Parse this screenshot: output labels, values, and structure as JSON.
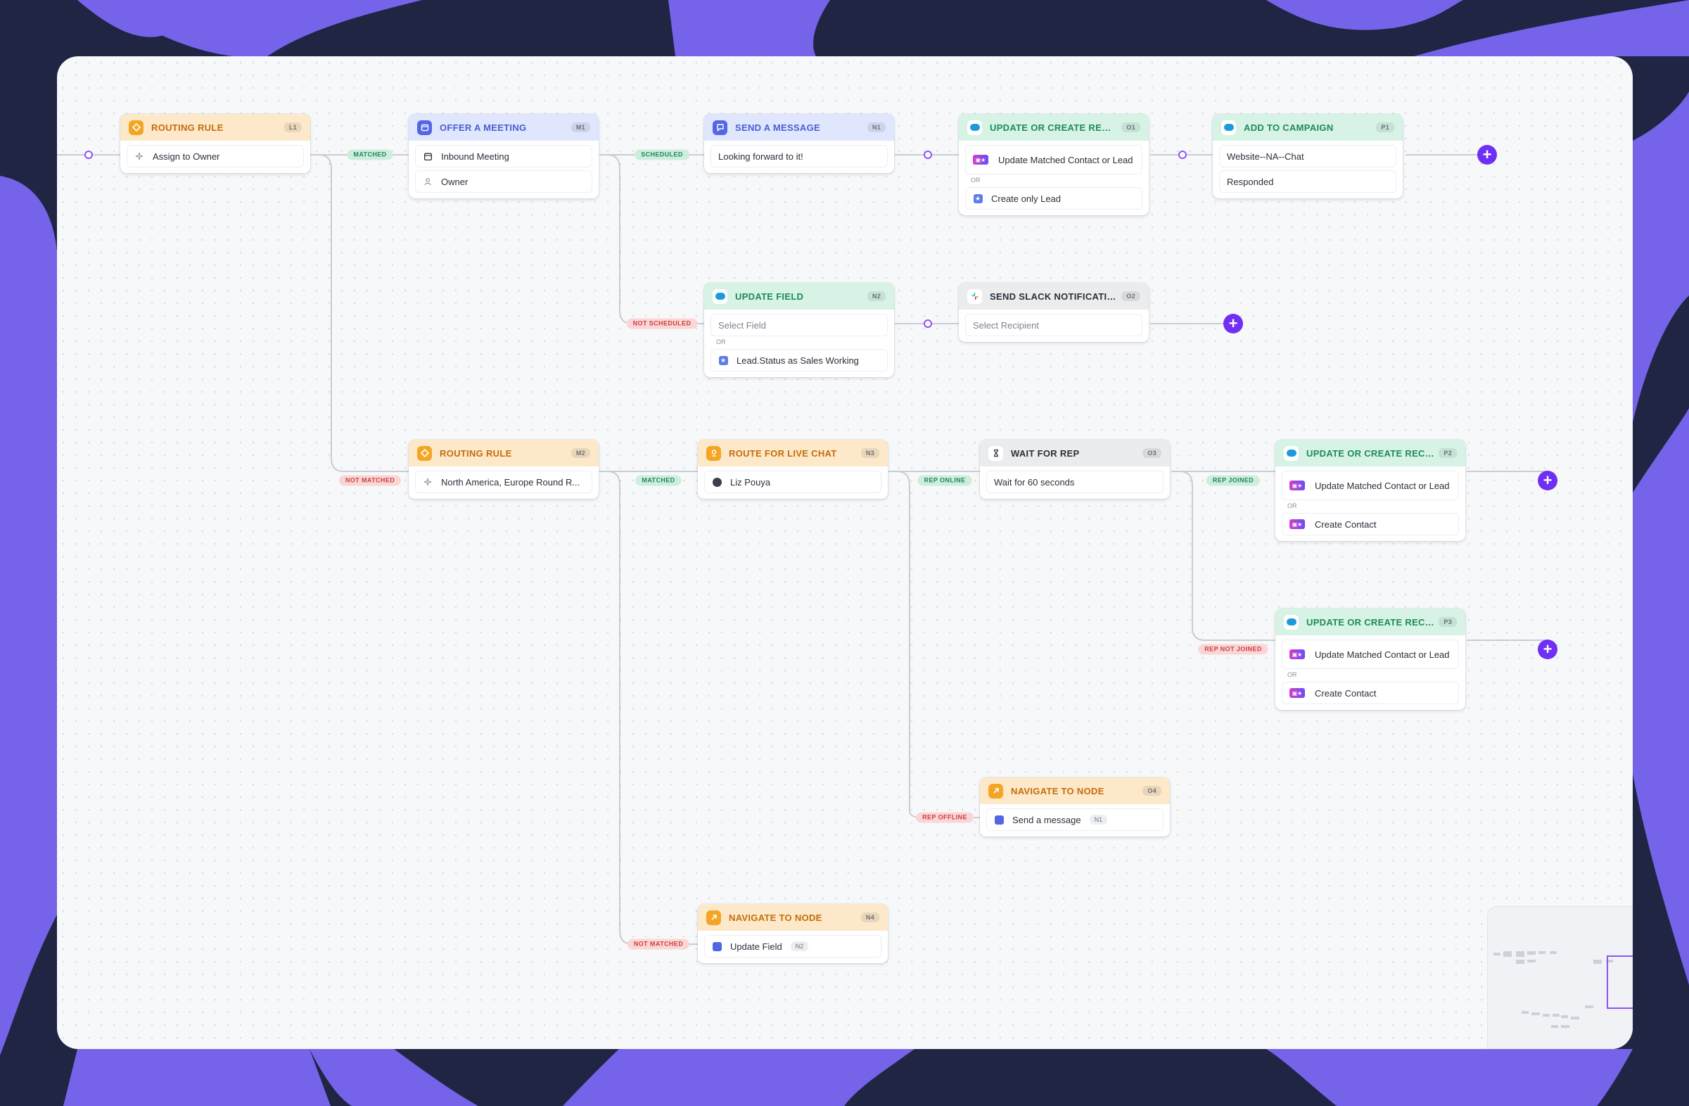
{
  "colors": {
    "accent": "#6f2ff5",
    "orange": "#f5a524",
    "blue": "#5366e3",
    "green": "#1f8a58",
    "backdrop_purple": "#7563ea",
    "backdrop_navy": "#1f2543"
  },
  "edge_labels": {
    "matched_1": "MATCHED",
    "scheduled": "SCHEDULED",
    "not_scheduled": "NOT SCHEDULED",
    "not_matched_1": "NOT MATCHED",
    "matched_2": "MATCHED",
    "rep_online": "REP ONLINE",
    "rep_joined": "REP JOINED",
    "rep_not_joined": "REP NOT JOINED",
    "rep_offline": "REP OFFLINE",
    "not_matched_2": "NOT MATCHED"
  },
  "nodes": {
    "l1": {
      "title": "ROUTING RULE",
      "badge": "L1",
      "icon": "routing-icon",
      "rows": [
        "Assign to Owner"
      ]
    },
    "m1": {
      "title": "OFFER A MEETING",
      "badge": "M1",
      "icon": "calendar-icon",
      "rows": [
        "Inbound Meeting",
        "Owner"
      ]
    },
    "n1": {
      "title": "SEND A MESSAGE",
      "badge": "N1",
      "icon": "chat-icon",
      "rows": [
        "Looking forward to it!"
      ]
    },
    "o1": {
      "title": "UPDATE OR CREATE RECO...",
      "badge": "O1",
      "icon": "salesforce-icon",
      "rows": [
        "Update Matched Contact or Lead",
        "Create only Lead"
      ],
      "or": "OR"
    },
    "p1": {
      "title": "ADD TO CAMPAIGN",
      "badge": "P1",
      "icon": "salesforce-icon",
      "rows": [
        "Website--NA--Chat",
        "Responded"
      ]
    },
    "n2": {
      "title": "UPDATE FIELD",
      "badge": "N2",
      "icon": "salesforce-icon",
      "rows": [
        "Select Field",
        "Lead.Status as Sales Working"
      ],
      "or": "OR"
    },
    "o2": {
      "title": "SEND SLACK NOTIFICATION",
      "badge": "O2",
      "icon": "slack-icon",
      "rows": [
        "Select Recipient"
      ]
    },
    "m2": {
      "title": "ROUTING RULE",
      "badge": "M2",
      "icon": "routing-icon",
      "rows": [
        "North America, Europe Round R..."
      ]
    },
    "n3": {
      "title": "ROUTE FOR LIVE CHAT",
      "badge": "N3",
      "icon": "person-icon",
      "rows": [
        "Liz Pouya"
      ]
    },
    "o3": {
      "title": "WAIT FOR REP",
      "badge": "O3",
      "icon": "hourglass-icon",
      "rows": [
        "Wait for 60 seconds"
      ]
    },
    "p2": {
      "title": "UPDATE OR CREATE RECO...",
      "badge": "P2",
      "icon": "salesforce-icon",
      "rows": [
        "Update Matched Contact or Lead",
        "Create Contact"
      ],
      "or": "OR"
    },
    "p3": {
      "title": "UPDATE OR CREATE RECO...",
      "badge": "P3",
      "icon": "salesforce-icon",
      "rows": [
        "Update Matched Contact or Lead",
        "Create Contact"
      ],
      "or": "OR"
    },
    "o4": {
      "title": "NAVIGATE TO NODE",
      "badge": "O4",
      "icon": "arrow-icon",
      "rows": [
        "Send a message"
      ],
      "row_badge": "N1"
    },
    "n4": {
      "title": "NAVIGATE TO NODE",
      "badge": "N4",
      "icon": "arrow-icon",
      "rows": [
        "Update Field"
      ],
      "row_badge": "N2"
    }
  }
}
